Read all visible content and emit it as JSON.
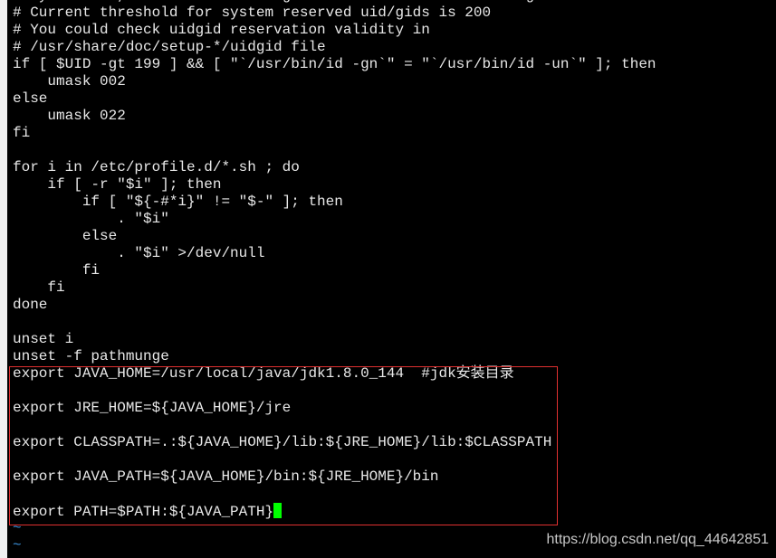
{
  "editor": {
    "lines": [
      "# By default, we want umask to get set. This sets it for login shell",
      "# Current threshold for system reserved uid/gids is 200",
      "# You could check uidgid reservation validity in",
      "# /usr/share/doc/setup-*/uidgid file",
      "if [ $UID -gt 199 ] && [ \"`/usr/bin/id -gn`\" = \"`/usr/bin/id -un`\" ]; then",
      "    umask 002",
      "else",
      "    umask 022",
      "fi",
      "",
      "for i in /etc/profile.d/*.sh ; do",
      "    if [ -r \"$i\" ]; then",
      "        if [ \"${-#*i}\" != \"$-\" ]; then",
      "            . \"$i\"",
      "        else",
      "            . \"$i\" >/dev/null",
      "        fi",
      "    fi",
      "done",
      "",
      "unset i",
      "unset -f pathmunge",
      "export JAVA_HOME=/usr/local/java/jdk1.8.0_144  #jdk安装目录",
      "",
      "export JRE_HOME=${JAVA_HOME}/jre",
      "",
      "export CLASSPATH=.:${JAVA_HOME}/lib:${JRE_HOME}/lib:$CLASSPATH",
      "",
      "export JAVA_PATH=${JAVA_HOME}/bin:${JRE_HOME}/bin",
      "",
      "export PATH=$PATH:${JAVA_PATH}"
    ],
    "empty_line_marker": "~",
    "cursor_color": "#00ff00",
    "highlight_color": "#e03030"
  },
  "watermark": "https://blog.csdn.net/qq_44642851"
}
